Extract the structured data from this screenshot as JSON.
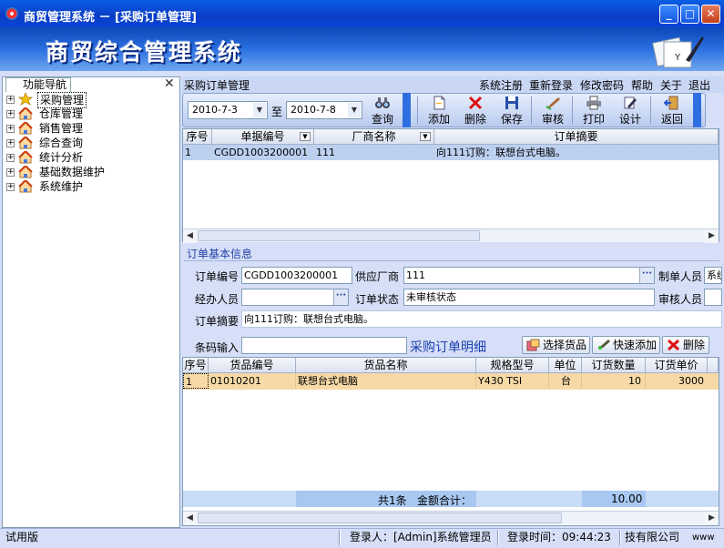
{
  "window": {
    "title": "商贸管理系统 － [采购订单管理]"
  },
  "banner": {
    "title": "商贸综合管理系统",
    "logo_letter": "Y"
  },
  "nav": {
    "tab_label": "功能导航",
    "items": [
      {
        "label": "采购管理",
        "icon": "star-icon"
      },
      {
        "label": "仓库管理",
        "icon": "house-icon"
      },
      {
        "label": "销售管理",
        "icon": "house-icon"
      },
      {
        "label": "综合查询",
        "icon": "house-icon"
      },
      {
        "label": "统计分析",
        "icon": "house-icon"
      },
      {
        "label": "基础数据维护",
        "icon": "house-icon"
      },
      {
        "label": "系统维护",
        "icon": "house-icon"
      }
    ]
  },
  "menubar": {
    "form_title": "采购订单管理",
    "items": [
      "系统注册",
      "重新登录",
      "修改密码",
      "帮助",
      "关于",
      "退出"
    ]
  },
  "toolbar": {
    "date_from": "2010-7-3",
    "date_sep": "至",
    "date_to": "2010-7-8",
    "query": "查询",
    "add": "添加",
    "delete": "删除",
    "save": "保存",
    "audit": "审核",
    "print": "打印",
    "design": "设计",
    "back": "返回"
  },
  "order_grid": {
    "headers": [
      "序号",
      "单据编号",
      "厂商名称",
      "订单摘要"
    ],
    "rows": [
      {
        "no": "1",
        "code": "CGDD1003200001",
        "vendor": "111",
        "summary": "向111订购：联想台式电脑。"
      }
    ]
  },
  "order_info": {
    "section_title": "订单基本信息",
    "order_no_label": "订单编号",
    "order_no": "CGDD1003200001",
    "supplier_label": "供应厂商",
    "supplier": "111",
    "maker_label": "制单人员",
    "maker": "系统",
    "handler_label": "经办人员",
    "handler": "",
    "status_label": "订单状态",
    "status": "未审核状态",
    "auditor_label": "审核人员",
    "auditor": "",
    "summary_label": "订单摘要",
    "summary": "向111订购：联想台式电脑。"
  },
  "detail": {
    "barcode_label": "条码输入",
    "barcode": "",
    "title": "采购订单明细",
    "select_btn": "选择货品",
    "quick_add_btn": "快速添加",
    "delete_btn": "删除",
    "headers": [
      "序号",
      "货品编号",
      "货品名称",
      "规格型号",
      "单位",
      "订货数量",
      "订货单价"
    ],
    "rows": [
      {
        "no": "1",
        "code": "01010201",
        "name": "联想台式电脑",
        "spec": "Y430 TSI",
        "unit": "台",
        "qty": "10",
        "price": "3000"
      }
    ],
    "footer_count": "共1条",
    "footer_total_label": "金额合计：",
    "footer_qty": "10.00"
  },
  "status": {
    "left": "试用版",
    "user": "登录人：[Admin]系统管理员",
    "time": "登录时间：09:44:23",
    "company": "技有限公司",
    "extra": "www"
  },
  "colors": {
    "title_blue": "#0a50d8",
    "selected_row": "#bcd0f0",
    "detail_row": "#f6d9a6",
    "total_bar": "#a8c8f2"
  }
}
